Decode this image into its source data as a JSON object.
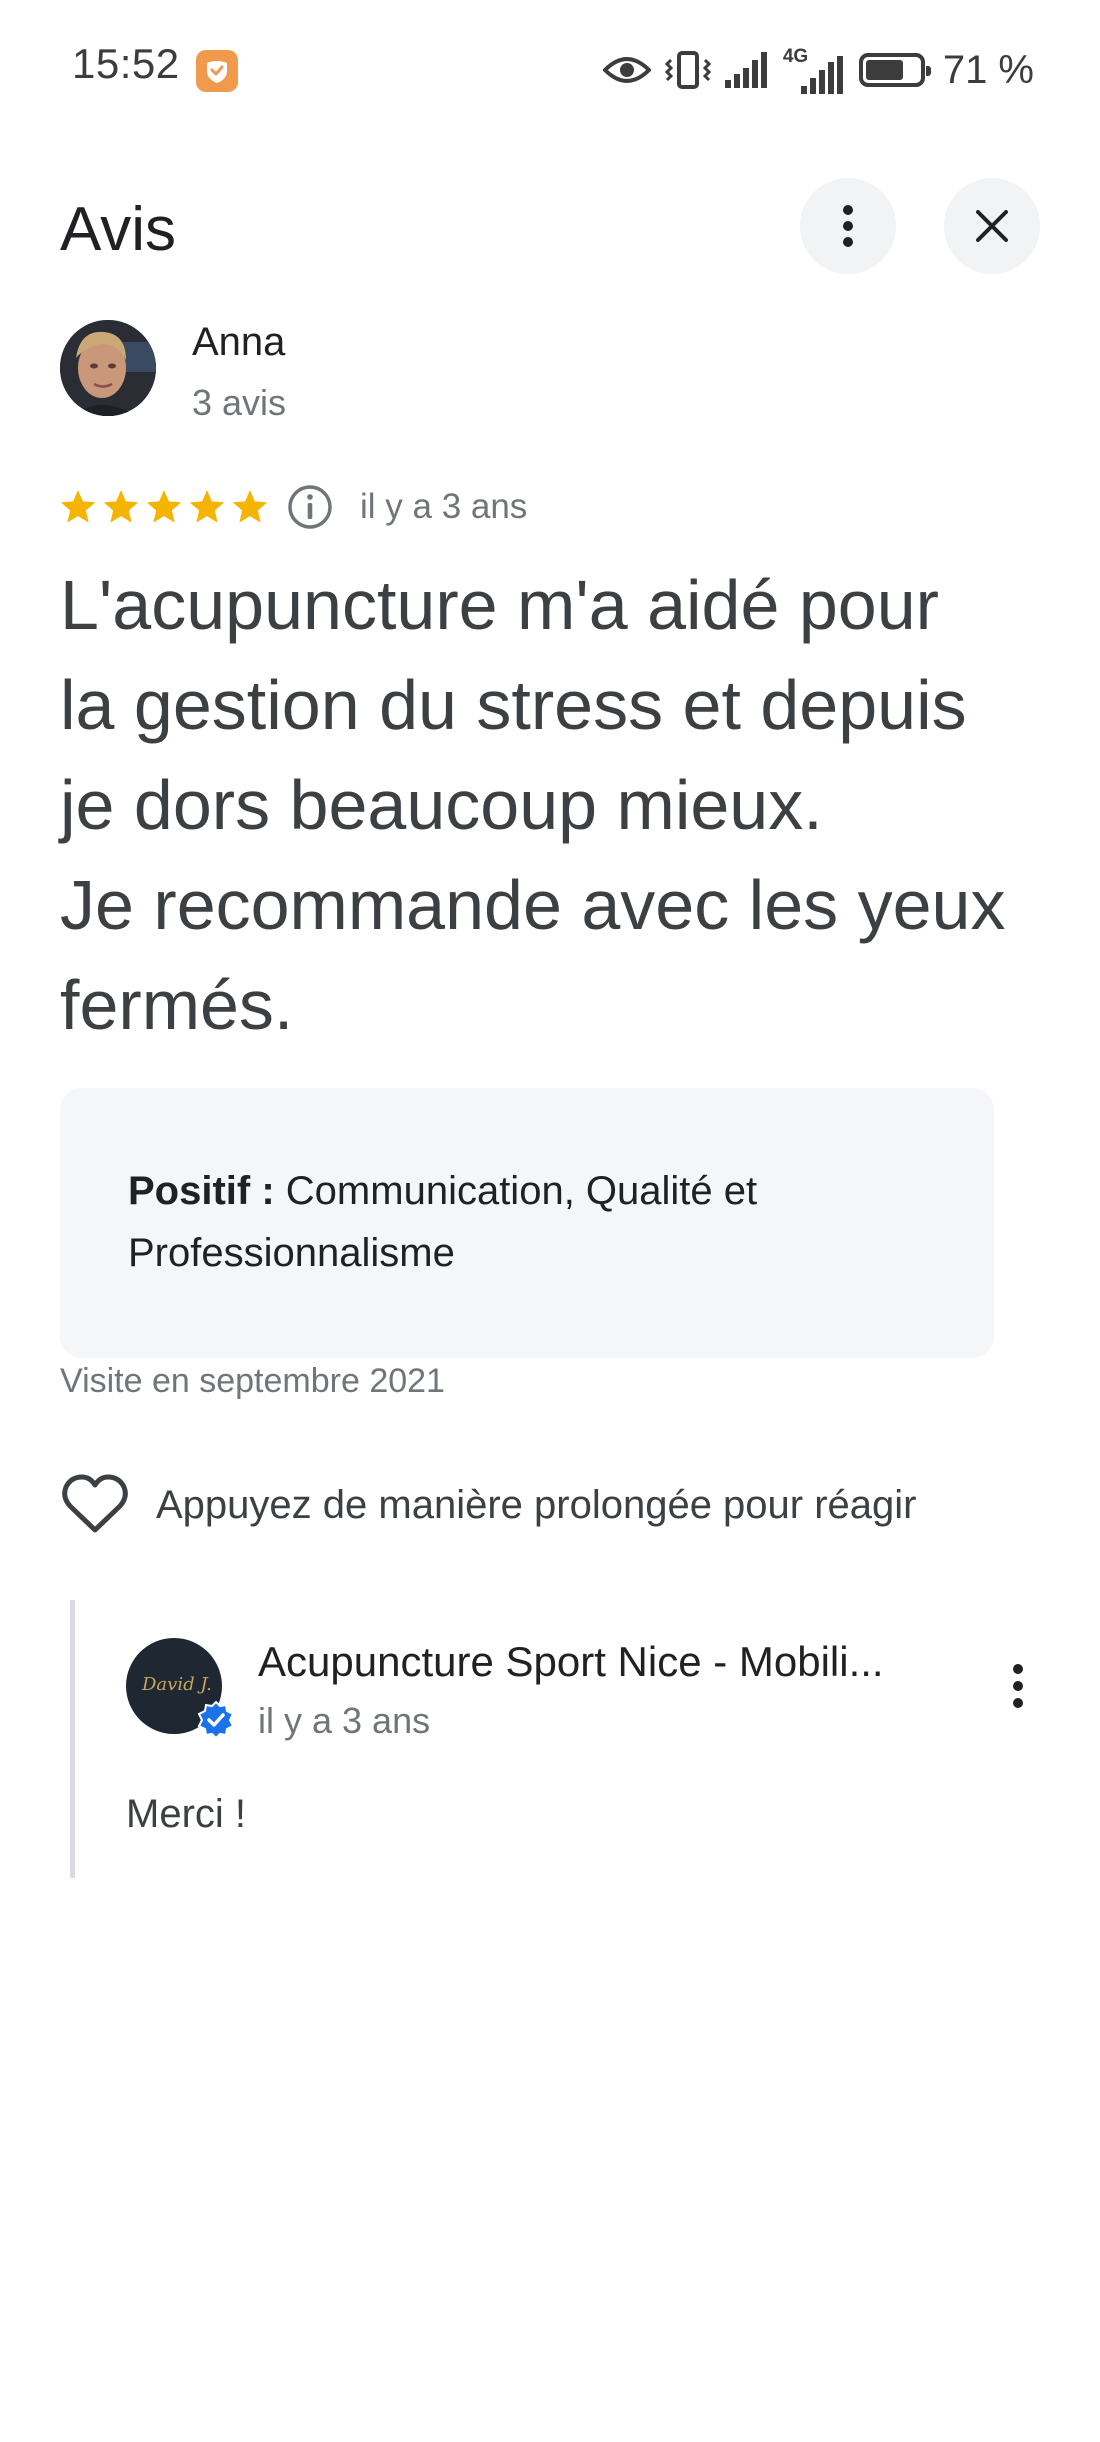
{
  "status_bar": {
    "time": "15:52",
    "network": "4G",
    "battery_percent_label": "71 %",
    "battery_level": 0.71,
    "icons": [
      "app-notification-icon",
      "eye-icon",
      "vibrate-icon",
      "signal-icon",
      "signal-4g-icon",
      "battery-icon"
    ]
  },
  "header": {
    "title": "Avis",
    "more_icon": "more-vert-icon",
    "close_icon": "close-icon"
  },
  "reviewer": {
    "name": "Anna",
    "review_count": "3 avis"
  },
  "review": {
    "rating": 5,
    "max_rating": 5,
    "date": "il y a 3 ans",
    "text": "L'acupuncture m'a aidé pour\nla gestion du stress et depuis\nje dors beaucoup mieux.\nJe recommande avec les yeux\nfermés.",
    "positive_label": "Positif :",
    "positive_text": "Communication, Qualité et Professionnalisme",
    "visit": "Visite en septembre 2021"
  },
  "reaction": {
    "label": "Appuyez de manière prolongée pour réagir",
    "icon": "heart-outline-icon"
  },
  "owner_reply": {
    "name": "Acupuncture Sport Nice - Mobili...",
    "date": "il y a 3 ans",
    "text": "Merci !",
    "verified": true
  },
  "colors": {
    "star": "#f4b400",
    "verified": "#1a73e8",
    "text_primary": "#202124",
    "text_secondary": "#70757a"
  }
}
